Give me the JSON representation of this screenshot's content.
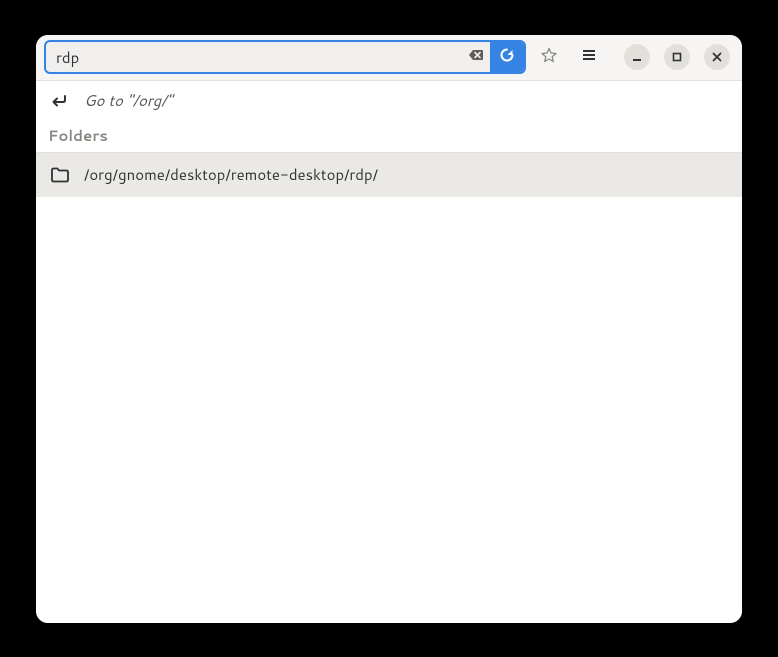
{
  "search": {
    "value": "rdp"
  },
  "goto": {
    "text": "Go to \"/org/\""
  },
  "sections": {
    "folders_label": "Folders"
  },
  "folders": [
    {
      "path": "/org/gnome/desktop/remote-desktop/rdp/"
    }
  ]
}
